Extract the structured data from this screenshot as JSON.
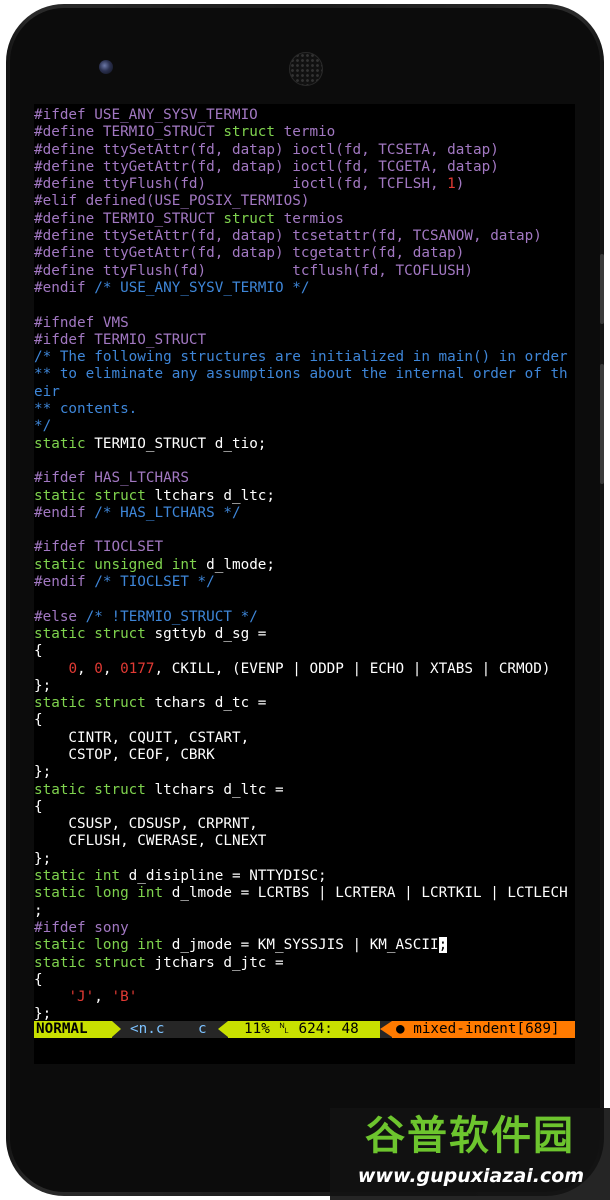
{
  "editor": {
    "lines": [
      [
        {
          "t": "#ifdef USE_ANY_SYSV_TERMIO",
          "c": "pp"
        }
      ],
      [
        {
          "t": "#define TERMIO_STRUCT ",
          "c": "pp"
        },
        {
          "t": "struct",
          "c": "kw"
        },
        {
          "t": " termio",
          "c": "pp"
        }
      ],
      [
        {
          "t": "#define ttySetAttr(fd, datap) ioctl(fd, TCSETA, datap)",
          "c": "pp"
        }
      ],
      [
        {
          "t": "#define ttyGetAttr(fd, datap) ioctl(fd, TCGETA, datap)",
          "c": "pp"
        }
      ],
      [
        {
          "t": "#define ttyFlush(fd)          ioctl(fd, TCFLSH, ",
          "c": "pp"
        },
        {
          "t": "1",
          "c": "num"
        },
        {
          "t": ")",
          "c": "pp"
        }
      ],
      [
        {
          "t": "#elif defined(USE_POSIX_TERMIOS)",
          "c": "pp"
        }
      ],
      [
        {
          "t": "#define TERMIO_STRUCT ",
          "c": "pp"
        },
        {
          "t": "struct",
          "c": "kw"
        },
        {
          "t": " termios",
          "c": "pp"
        }
      ],
      [
        {
          "t": "#define ttySetAttr(fd, datap) tcsetattr(fd, TCSANOW, datap)",
          "c": "pp"
        }
      ],
      [
        {
          "t": "#define ttyGetAttr(fd, datap) tcgetattr(fd, datap)",
          "c": "pp"
        }
      ],
      [
        {
          "t": "#define ttyFlush(fd)          tcflush(fd, TCOFLUSH)",
          "c": "pp"
        }
      ],
      [
        {
          "t": "#endif ",
          "c": "pp"
        },
        {
          "t": "/* USE_ANY_SYSV_TERMIO */",
          "c": "cm"
        }
      ],
      [
        {
          "t": "",
          "c": "txt"
        }
      ],
      [
        {
          "t": "#ifndef VMS",
          "c": "pp"
        }
      ],
      [
        {
          "t": "#ifdef TERMIO_STRUCT",
          "c": "pp"
        }
      ],
      [
        {
          "t": "/* The following structures are initialized in main() in order",
          "c": "cm"
        }
      ],
      [
        {
          "t": "** to eliminate any assumptions about the internal order of th",
          "c": "cm"
        }
      ],
      [
        {
          "t": "eir",
          "c": "cm"
        }
      ],
      [
        {
          "t": "** contents.",
          "c": "cm"
        }
      ],
      [
        {
          "t": "*/",
          "c": "cm"
        }
      ],
      [
        {
          "t": "static",
          "c": "kw"
        },
        {
          "t": " TERMIO_STRUCT d_tio;",
          "c": "txt"
        }
      ],
      [
        {
          "t": "",
          "c": "txt"
        }
      ],
      [
        {
          "t": "#ifdef HAS_LTCHARS",
          "c": "pp"
        }
      ],
      [
        {
          "t": "static struct",
          "c": "kw"
        },
        {
          "t": " ltchars d_ltc;",
          "c": "txt"
        }
      ],
      [
        {
          "t": "#endif ",
          "c": "pp"
        },
        {
          "t": "/* HAS_LTCHARS */",
          "c": "cm"
        }
      ],
      [
        {
          "t": "",
          "c": "txt"
        }
      ],
      [
        {
          "t": "#ifdef TIOCLSET",
          "c": "pp"
        }
      ],
      [
        {
          "t": "static unsigned int",
          "c": "kw"
        },
        {
          "t": " d_lmode;",
          "c": "txt"
        }
      ],
      [
        {
          "t": "#endif ",
          "c": "pp"
        },
        {
          "t": "/* TIOCLSET */",
          "c": "cm"
        }
      ],
      [
        {
          "t": "",
          "c": "txt"
        }
      ],
      [
        {
          "t": "#else ",
          "c": "pp"
        },
        {
          "t": "/* !TERMIO_STRUCT */",
          "c": "cm"
        }
      ],
      [
        {
          "t": "static struct",
          "c": "kw"
        },
        {
          "t": " sgttyb d_sg =",
          "c": "txt"
        }
      ],
      [
        {
          "t": "{",
          "c": "txt"
        }
      ],
      [
        {
          "t": "    ",
          "c": "txt"
        },
        {
          "t": "0",
          "c": "num"
        },
        {
          "t": ", ",
          "c": "txt"
        },
        {
          "t": "0",
          "c": "num"
        },
        {
          "t": ", ",
          "c": "txt"
        },
        {
          "t": "0177",
          "c": "num"
        },
        {
          "t": ", CKILL, (EVENP | ODDP | ECHO | XTABS | CRMOD)",
          "c": "txt"
        }
      ],
      [
        {
          "t": "};",
          "c": "txt"
        }
      ],
      [
        {
          "t": "static struct",
          "c": "kw"
        },
        {
          "t": " tchars d_tc =",
          "c": "txt"
        }
      ],
      [
        {
          "t": "{",
          "c": "txt"
        }
      ],
      [
        {
          "t": "    CINTR, CQUIT, CSTART,",
          "c": "txt"
        }
      ],
      [
        {
          "t": "    CSTOP, CEOF, CBRK",
          "c": "txt"
        }
      ],
      [
        {
          "t": "};",
          "c": "txt"
        }
      ],
      [
        {
          "t": "static struct",
          "c": "kw"
        },
        {
          "t": " ltchars d_ltc =",
          "c": "txt"
        }
      ],
      [
        {
          "t": "{",
          "c": "txt"
        }
      ],
      [
        {
          "t": "    CSUSP, CDSUSP, CRPRNT,",
          "c": "txt"
        }
      ],
      [
        {
          "t": "    CFLUSH, CWERASE, CLNEXT",
          "c": "txt"
        }
      ],
      [
        {
          "t": "};",
          "c": "txt"
        }
      ],
      [
        {
          "t": "static int",
          "c": "kw"
        },
        {
          "t": " d_disipline = NTTYDISC;",
          "c": "txt"
        }
      ],
      [
        {
          "t": "static long int",
          "c": "kw"
        },
        {
          "t": " d_lmode = LCRTBS | LCRTERA | LCRTKIL | LCTLECH",
          "c": "txt"
        }
      ],
      [
        {
          "t": ";",
          "c": "txt"
        }
      ],
      [
        {
          "t": "#ifdef sony",
          "c": "pp"
        }
      ],
      [
        {
          "t": "static long int",
          "c": "kw"
        },
        {
          "t": " d_jmode = KM_SYSSJIS | KM_ASCII",
          "c": "txt"
        },
        {
          "t": ";",
          "c": "cursor"
        }
      ],
      [
        {
          "t": "static struct",
          "c": "kw"
        },
        {
          "t": " jtchars d_jtc =",
          "c": "txt"
        }
      ],
      [
        {
          "t": "{",
          "c": "txt"
        }
      ],
      [
        {
          "t": "    ",
          "c": "txt"
        },
        {
          "t": "'J'",
          "c": "str"
        },
        {
          "t": ", ",
          "c": "txt"
        },
        {
          "t": "'B'",
          "c": "str"
        }
      ],
      [
        {
          "t": "};",
          "c": "txt"
        }
      ]
    ]
  },
  "status": {
    "mode": "NORMAL",
    "file": "<n.c",
    "filetype": "c",
    "position": "11% ␤ 624: 48",
    "warning": "● mixed-indent[689]"
  },
  "watermark": {
    "title": "谷普软件园",
    "url": "www.gupuxiazai.com"
  },
  "colors": {
    "preprocessor": "#a278c2",
    "keyword": "#7fd34e",
    "comment": "#3e86d8",
    "number": "#e23a34",
    "mode_bg": "#c8e000",
    "warning_bg": "#ff7a00"
  }
}
